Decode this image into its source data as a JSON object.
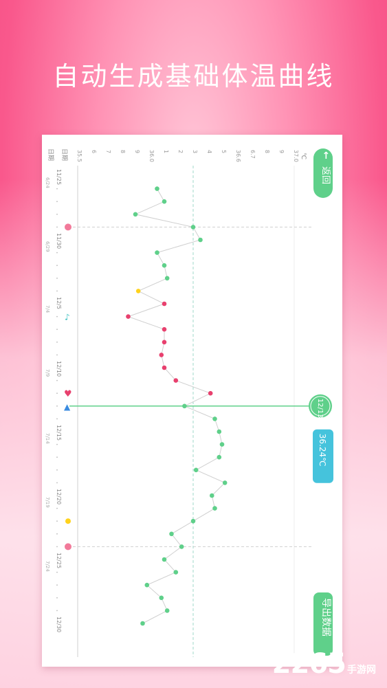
{
  "headline": "自动生成基础体温曲线",
  "chart": {
    "header_date": "日期",
    "header_days": "日期",
    "back_label": "返回",
    "export_label": "导出数据",
    "unit": "℃",
    "temp_ticks": [
      "35.5",
      "6",
      "7",
      "8",
      "9",
      "36.0",
      "1",
      "2",
      "3",
      "4",
      "5",
      "36.6",
      "6.7",
      "8",
      "9",
      "37.0"
    ],
    "date_labels": [
      "11/25",
      "11/30",
      "12/5",
      "12/10",
      "12/15",
      "12/20",
      "12/25",
      "12/30"
    ],
    "sub_labels": [
      "6/24",
      "6/29",
      "7/4",
      "7/9",
      "7/14",
      "7/19",
      "7/24"
    ],
    "selected_date": "12/13",
    "selected_temp": "36.24℃"
  },
  "chart_data": {
    "type": "line",
    "title": "",
    "x_label": "日期",
    "y_label": "℃",
    "ylim": [
      35.5,
      37.0
    ],
    "coverline": 36.3,
    "x": [
      "11/26",
      "11/27",
      "11/28",
      "11/29",
      "11/30",
      "12/1",
      "12/2",
      "12/3",
      "12/4",
      "12/5",
      "12/6",
      "12/7",
      "12/8",
      "12/9",
      "12/10",
      "12/11",
      "12/12",
      "12/13",
      "12/14",
      "12/15",
      "12/16",
      "12/17",
      "12/18",
      "12/19",
      "12/20",
      "12/21",
      "12/22",
      "12/23",
      "12/24",
      "12/25",
      "12/26",
      "12/27",
      "12/28",
      "12/29",
      "12/30"
    ],
    "y": [
      36.05,
      36.1,
      35.9,
      36.3,
      36.35,
      36.05,
      36.1,
      36.12,
      35.92,
      36.1,
      35.85,
      36.1,
      36.1,
      36.08,
      36.1,
      36.18,
      36.42,
      36.24,
      36.45,
      36.48,
      36.5,
      36.48,
      36.32,
      36.52,
      36.43,
      36.45,
      36.3,
      36.15,
      36.22,
      36.1,
      36.18,
      35.98,
      36.08,
      36.12,
      35.95
    ],
    "point_colors": [
      "#5fd08a",
      "#5fd08a",
      "#5fd08a",
      "#5fd08a",
      "#5fd08a",
      "#5fd08a",
      "#5fd08a",
      "#5fd08a",
      "#ffd21c",
      "#e8406e",
      "#e8406e",
      "#e8406e",
      "#e8406e",
      "#e8406e",
      "#e8406e",
      "#e8406e",
      "#e8406e",
      "#5fd08a",
      "#5fd08a",
      "#5fd08a",
      "#5fd08a",
      "#5fd08a",
      "#5fd08a",
      "#5fd08a",
      "#5fd08a",
      "#5fd08a",
      "#5fd08a",
      "#5fd08a",
      "#5fd08a",
      "#5fd08a",
      "#5fd08a",
      "#5fd08a",
      "#5fd08a",
      "#5fd08a",
      "#5fd08a"
    ],
    "colors": {
      "normal": "#5fd08a",
      "period": "#e8406e",
      "other": "#ffd21c",
      "accent_green": "#5fd08a",
      "accent_blue": "#45c3dc"
    }
  },
  "watermark": {
    "number": "2265",
    "site": "手游网"
  }
}
